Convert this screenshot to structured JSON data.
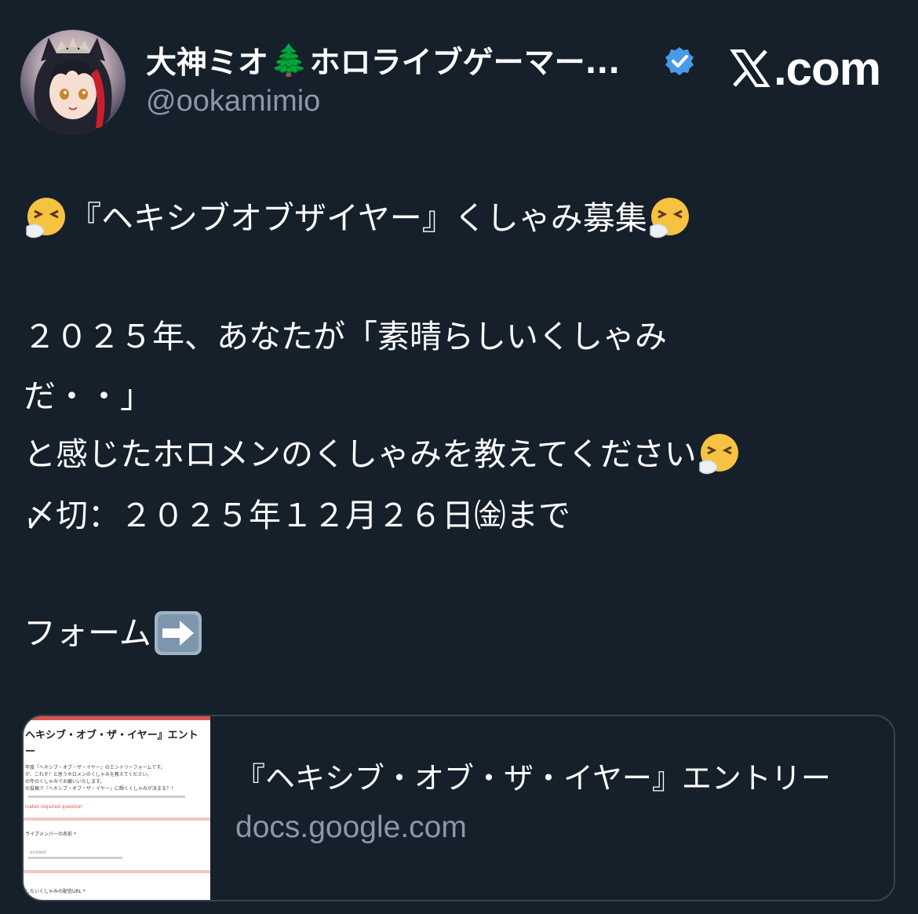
{
  "post": {
    "author": {
      "name_prefix": "大神ミオ",
      "name_tree": "🌲",
      "name_suffix": "ホロライブゲーマー...",
      "handle": "@ookamimio",
      "avatar_icon": "user-avatar-icon",
      "verified_icon": "verified-badge-icon",
      "verified_color": "#4a99e9"
    },
    "site": {
      "label": ".com",
      "logo_icon": "x-logo-icon"
    },
    "body": {
      "title": "『ヘキシブオブザイヤー』くしゃみ募集",
      "line1": "２０２５年、あなたが「素晴らしいくしゃみ",
      "line2": "だ・・」",
      "line3": "と感じたホロメンのくしゃみを教えてください",
      "line4": "〆切：２０２５年１２月２６日㈮まで",
      "line5": "フォーム",
      "sneeze_emoji": "sneezing-face-icon",
      "arrow_emoji": "right-arrow-icon"
    },
    "link_card": {
      "title": "『ヘキシブ・オブ・ザ・イヤー』エントリー",
      "domain": "docs.google.com",
      "thumb_title": "ヘキシブ・オブ・ザ・イヤー』エント",
      "thumb_second": "ー",
      "thumb_intro1": "年度『ヘキシブ・オブ・ザ・イヤー』のエントリーフォームです。",
      "thumb_intro2": "が、これぞ！と思うホロメンのくしゃみを教えてください。",
      "thumb_intro3": "の年のくしゃみでお願いいたします。",
      "thumb_intro4": "の投稿で『ヘキシブ・オブ・ザ・イヤー』に輝くくしゃみが決まる？！",
      "thumb_required": "icates required question",
      "thumb_field1": "ライブメンバーの名前 *",
      "thumb_placeholder": "answer",
      "thumb_field2": "したいくしゃみの配信URL *"
    },
    "colors": {
      "background": "#15202b",
      "secondary_text": "#8b98a5",
      "border": "#38444d"
    }
  }
}
